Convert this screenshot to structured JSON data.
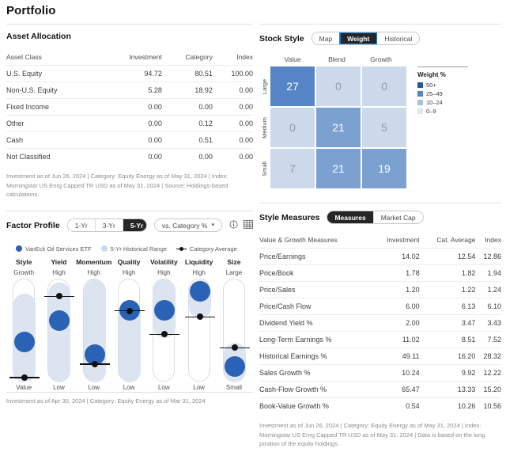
{
  "page": {
    "title": "Portfolio"
  },
  "asset_allocation": {
    "section_title": "Asset Allocation",
    "columns": [
      "Asset Class",
      "Investment",
      "Category",
      "Index"
    ],
    "rows": [
      {
        "label": "U.S. Equity",
        "investment": "94.72",
        "category": "80.51",
        "index": "100.00"
      },
      {
        "label": "Non-U.S. Equity",
        "investment": "5.28",
        "category": "18.92",
        "index": "0.00"
      },
      {
        "label": "Fixed Income",
        "investment": "0.00",
        "category": "0.00",
        "index": "0.00"
      },
      {
        "label": "Other",
        "investment": "0.00",
        "category": "0.12",
        "index": "0.00"
      },
      {
        "label": "Cash",
        "investment": "0.00",
        "category": "0.51",
        "index": "0.00"
      },
      {
        "label": "Not Classified",
        "investment": "0.00",
        "category": "0.00",
        "index": "0.00"
      }
    ],
    "footnote": "Investment as of Jun 26, 2024 | Category: Equity Energy as of May 31, 2024 | Index: Morningstar US Enrg Capped TR USD as of May 31, 2024 | Source: Holdings-based calculations."
  },
  "stock_style": {
    "section_title": "Stock Style",
    "tabs": [
      {
        "label": "Map",
        "active": false,
        "focused": false
      },
      {
        "label": "Weight",
        "active": true,
        "focused": true
      },
      {
        "label": "Historical",
        "active": false,
        "focused": false
      }
    ],
    "col_headers": [
      "Value",
      "Blend",
      "Growth"
    ],
    "row_headers": [
      "Large",
      "Medium",
      "Small"
    ],
    "grid": [
      [
        {
          "value": "27",
          "color": "#5585c4",
          "text_color": "#ffffff"
        },
        {
          "value": "0",
          "color": "#ccd9ea",
          "text_color": "#8c9bad"
        },
        {
          "value": "0",
          "color": "#ccd9ea",
          "text_color": "#8c9bad"
        }
      ],
      [
        {
          "value": "0",
          "color": "#ccd9ea",
          "text_color": "#8c9bad"
        },
        {
          "value": "21",
          "color": "#7ba1d0",
          "text_color": "#ffffff"
        },
        {
          "value": "5",
          "color": "#ccd9ea",
          "text_color": "#8c9bad"
        }
      ],
      [
        {
          "value": "7",
          "color": "#ccd9ea",
          "text_color": "#8c9bad"
        },
        {
          "value": "21",
          "color": "#7ba1d0",
          "text_color": "#ffffff"
        },
        {
          "value": "19",
          "color": "#7ba1d0",
          "text_color": "#ffffff"
        }
      ]
    ],
    "legend": {
      "title": "Weight %",
      "items": [
        {
          "label": "50+",
          "color": "#24579e"
        },
        {
          "label": "25–49",
          "color": "#5585c4"
        },
        {
          "label": "10–24",
          "color": "#a9c0de"
        },
        {
          "label": "0–9",
          "color": "#dde6f2"
        }
      ]
    }
  },
  "style_measures": {
    "section_title": "Style Measures",
    "tabs": [
      {
        "label": "Measures",
        "active": true
      },
      {
        "label": "Market Cap",
        "active": false
      }
    ],
    "columns": [
      "Value & Growth Measures",
      "Investment",
      "Cat. Average",
      "Index"
    ],
    "rows": [
      {
        "label": "Price/Earnings",
        "investment": "14.02",
        "cat_average": "12.54",
        "index": "12.86"
      },
      {
        "label": "Price/Book",
        "investment": "1.78",
        "cat_average": "1.82",
        "index": "1.94"
      },
      {
        "label": "Price/Sales",
        "investment": "1.20",
        "cat_average": "1.22",
        "index": "1.24"
      },
      {
        "label": "Price/Cash Flow",
        "investment": "6.00",
        "cat_average": "6.13",
        "index": "6.10"
      },
      {
        "label": "Dividend Yield %",
        "investment": "2.00",
        "cat_average": "3.47",
        "index": "3.43"
      },
      {
        "label": "Long-Term Earnings %",
        "investment": "11.02",
        "cat_average": "8.51",
        "index": "7.52"
      },
      {
        "label": "Historical Earnings %",
        "investment": "49.11",
        "cat_average": "16.20",
        "index": "28.32"
      },
      {
        "label": "Sales Growth %",
        "investment": "10.24",
        "cat_average": "9.92",
        "index": "12.22"
      },
      {
        "label": "Cash-Flow Growth %",
        "investment": "65.47",
        "cat_average": "13.33",
        "index": "15.20"
      },
      {
        "label": "Book-Value Growth %",
        "investment": "0.54",
        "cat_average": "10.26",
        "index": "10.56"
      }
    ],
    "footnote": "Investment as of Jun 26, 2024 | Category: Equity Energy as of May 31, 2024 | Index: Morningstar US Enrg Capped TR USD as of May 31, 2024 | Data is based on the long position of the equity holdings."
  },
  "factor_profile": {
    "section_title": "Factor Profile",
    "period_tabs": [
      {
        "label": "1-Yr",
        "active": false
      },
      {
        "label": "3-Yr",
        "active": false
      },
      {
        "label": "5-Yr",
        "active": true
      }
    ],
    "compare_select": {
      "label": "vs. Category %",
      "caret": "⌄"
    },
    "icons": [
      {
        "name": "info-icon",
        "glyph": "ⓘ"
      },
      {
        "name": "table-icon",
        "glyph": "▦"
      }
    ],
    "legend": [
      {
        "type": "dot",
        "label": "VanEck Oil Services ETF",
        "color": "#2a62b5"
      },
      {
        "type": "dot",
        "label": "5-Yr Historical Range",
        "color": "#cbd9ec"
      },
      {
        "type": "marker",
        "label": "Category Average",
        "color": "#111111"
      }
    ],
    "columns": [
      {
        "name": "Style",
        "top": "Growth",
        "bottom": "Value",
        "range_top_pct": 14,
        "range_bottom_pct": 100,
        "ball_pct": 61,
        "avg_pct": 95
      },
      {
        "name": "Yield",
        "top": "High",
        "bottom": "Low",
        "range_top_pct": 3,
        "range_bottom_pct": 100,
        "ball_pct": 40,
        "avg_pct": 16
      },
      {
        "name": "Momentum",
        "top": "High",
        "bottom": "Low",
        "range_top_pct": 0,
        "range_bottom_pct": 100,
        "ball_pct": 73,
        "avg_pct": 82
      },
      {
        "name": "Quality",
        "top": "High",
        "bottom": "Low",
        "range_top_pct": 22,
        "range_bottom_pct": 100,
        "ball_pct": 30,
        "avg_pct": 30
      },
      {
        "name": "Volatility",
        "top": "High",
        "bottom": "Low",
        "range_top_pct": 0,
        "range_bottom_pct": 57,
        "ball_pct": 30,
        "avg_pct": 53
      },
      {
        "name": "Liquidity",
        "top": "High",
        "bottom": "Low",
        "range_top_pct": 1,
        "range_bottom_pct": 38,
        "ball_pct": 12,
        "avg_pct": 36
      },
      {
        "name": "Size",
        "top": "Large",
        "bottom": "Small",
        "range_top_pct": 62,
        "range_bottom_pct": 100,
        "ball_pct": 85,
        "avg_pct": 66
      }
    ],
    "footnote": "Investment as of Apr 30, 2024 | Category: Equity Energy as of Mar 31, 2024"
  }
}
